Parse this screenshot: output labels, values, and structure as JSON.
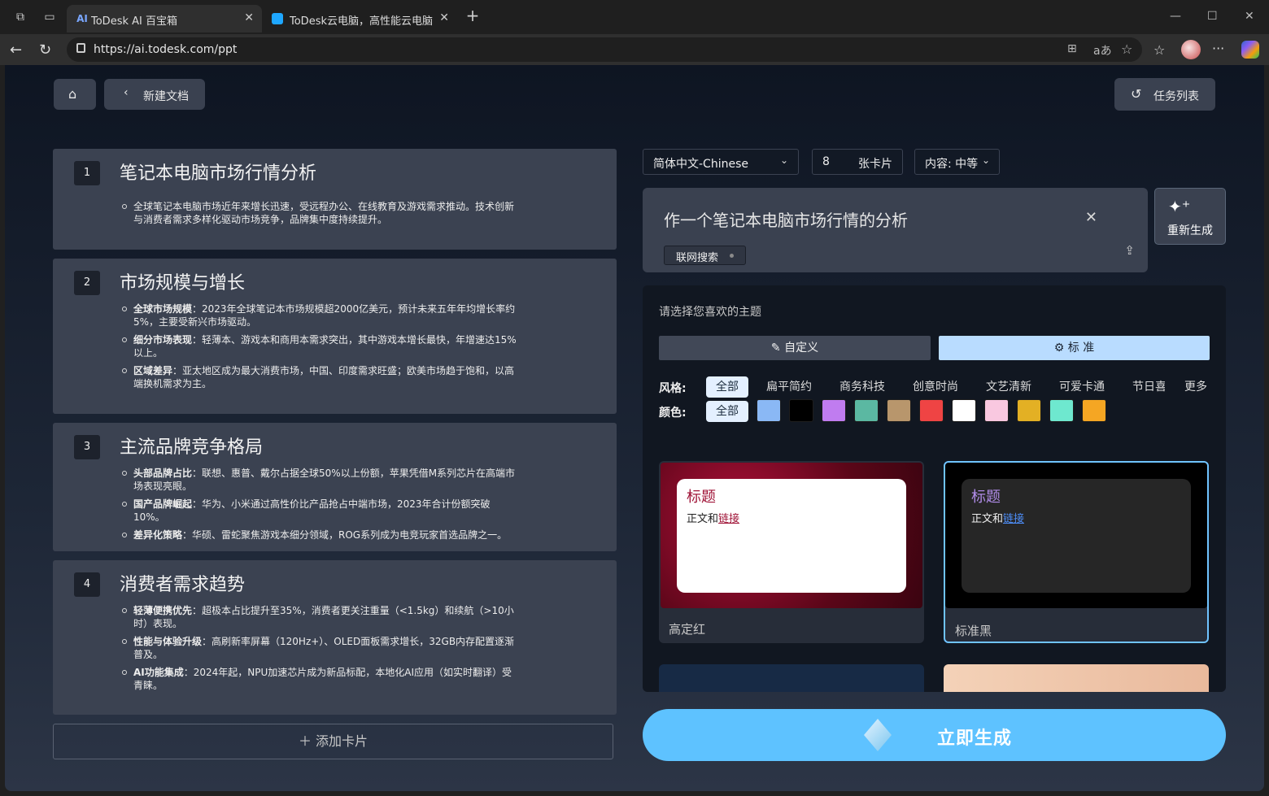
{
  "browser": {
    "tabs": [
      {
        "title": "ToDesk AI 百宝箱",
        "favicon": "AI"
      },
      {
        "title": "ToDesk云电脑，高性能云电脑，云",
        "favicon": "td-logo"
      }
    ],
    "url": "https://ai.todesk.com/ppt",
    "icons": {
      "workspaces": "workspaces-icon",
      "tab_actions": "tab-actions-icon",
      "new_tab": "+",
      "minimize": "—",
      "maximize": "☐",
      "close": "✕",
      "back": "←",
      "reload": "↻",
      "lock": "lock-icon",
      "split": "split-screen-icon",
      "read_aloud": "read-aloud-icon",
      "favorite": "☆",
      "favorites": "favorites-icon",
      "menu": "···"
    }
  },
  "toolbar": {
    "home_icon": "⌂",
    "back_label": "新建文档",
    "task_list_label": "任务列表"
  },
  "cards": [
    {
      "number": "1",
      "title": "笔记本电脑市场行情分析",
      "bullets": [
        {
          "bold": "",
          "text": "全球笔记本电脑市场近年来增长迅速，受远程办公、在线教育及游戏需求推动。技术创新与消费者需求多样化驱动市场竞争，品牌集中度持续提升。"
        }
      ]
    },
    {
      "number": "2",
      "title": "市场规模与增长",
      "bullets": [
        {
          "bold": "全球市场规模",
          "text": "：2023年全球笔记本市场规模超2000亿美元，预计未来五年年均增长率约5%，主要受新兴市场驱动。"
        },
        {
          "bold": "细分市场表现",
          "text": "：轻薄本、游戏本和商用本需求突出，其中游戏本增长最快，年增速达15%以上。"
        },
        {
          "bold": "区域差异",
          "text": "：亚太地区成为最大消费市场，中国、印度需求旺盛；欧美市场趋于饱和，以高端换机需求为主。"
        }
      ]
    },
    {
      "number": "3",
      "title": "主流品牌竞争格局",
      "bullets": [
        {
          "bold": "头部品牌占比",
          "text": "：联想、惠普、戴尔占据全球50%以上份额，苹果凭借M系列芯片在高端市场表现亮眼。"
        },
        {
          "bold": "国产品牌崛起",
          "text": "：华为、小米通过高性价比产品抢占中端市场，2023年合计份额突破10%。"
        },
        {
          "bold": "差异化策略",
          "text": "：华硕、雷蛇聚焦游戏本细分领域，ROG系列成为电竞玩家首选品牌之一。"
        }
      ]
    },
    {
      "number": "4",
      "title": "消费者需求趋势",
      "bullets": [
        {
          "bold": "轻薄便携优先",
          "text": "：超极本占比提升至35%，消费者更关注重量（<1.5kg）和续航（>10小时）表现。"
        },
        {
          "bold": "性能与体验升级",
          "text": "：高刷新率屏幕（120Hz+）、OLED面板需求增长，32GB内存配置逐渐普及。"
        },
        {
          "bold": "AI功能集成",
          "text": "：2024年起，NPU加速芯片成为新品标配，本地化AI应用（如实时翻译）受青睐。"
        }
      ]
    }
  ],
  "add_card_label": "添加卡片",
  "settings": {
    "language": "简体中文-Chinese",
    "card_count": "8",
    "card_unit": "张卡片",
    "content_level": "内容: 中等"
  },
  "prompt": {
    "text": "作一个笔记本电脑市场行情的分析",
    "web_search_label": "联网搜索",
    "regenerate_label": "重新生成"
  },
  "theme": {
    "title": "请选择您喜欢的主题",
    "custom_label": "自定义",
    "standard_label": "标 准",
    "style_label": "风格:",
    "styles": [
      "全部",
      "扁平简约",
      "商务科技",
      "创意时尚",
      "文艺清新",
      "可爱卡通",
      "节日喜庆"
    ],
    "more_label": "更多",
    "color_label": "颜色:",
    "color_all_label": "全部",
    "colors": [
      "#8ab8f5",
      "#000000",
      "#c07cf0",
      "#5bb8a2",
      "#b8966c",
      "#ef4444",
      "#ffffff",
      "#f9c8e0",
      "#e3b024",
      "#6ee8cf",
      "#f5a623"
    ],
    "cards": [
      {
        "heading": "标题",
        "body": "正文和",
        "link": "链接",
        "name": "高定红"
      },
      {
        "heading": "标题",
        "body": "正文和",
        "link": "链接",
        "name": "标准黑"
      }
    ]
  },
  "generate_label": "立即生成"
}
